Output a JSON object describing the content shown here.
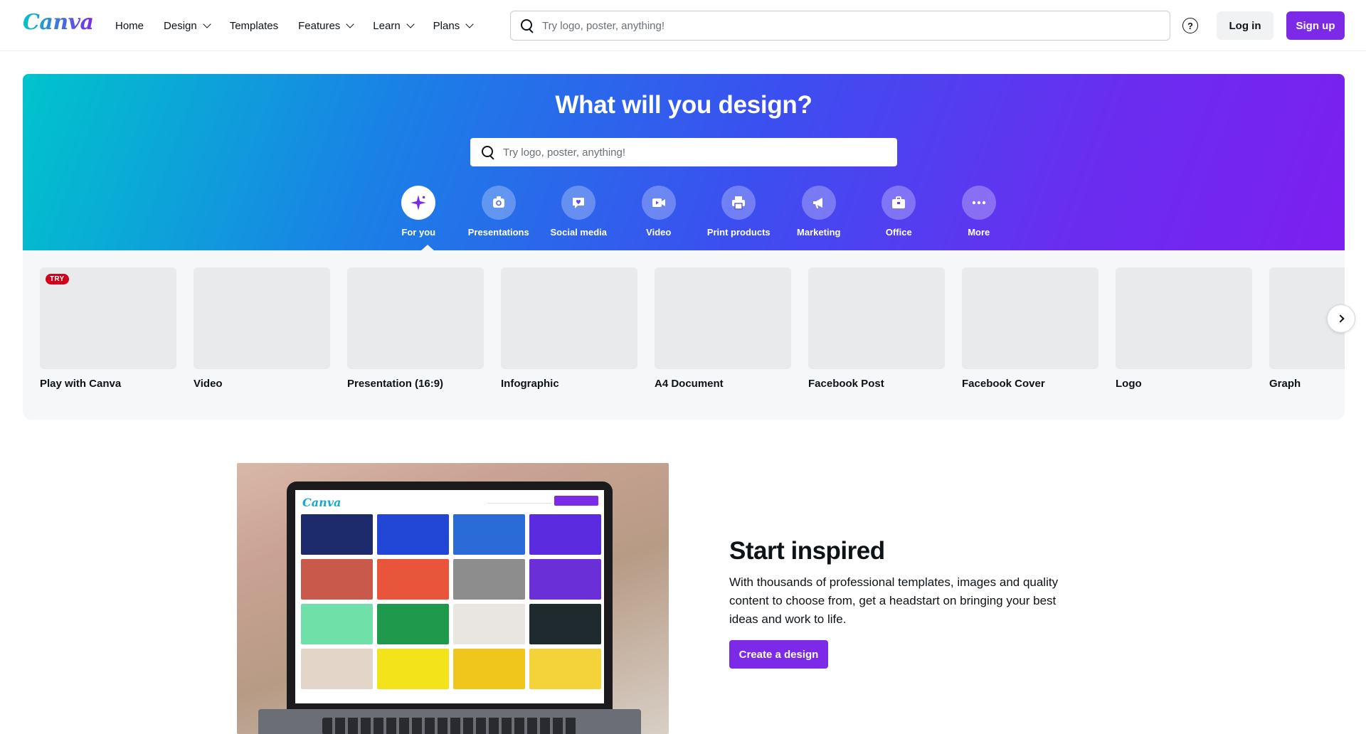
{
  "header": {
    "logo": "Canva",
    "nav": [
      {
        "label": "Home",
        "dropdown": false
      },
      {
        "label": "Design",
        "dropdown": true
      },
      {
        "label": "Templates",
        "dropdown": false
      },
      {
        "label": "Features",
        "dropdown": true
      },
      {
        "label": "Learn",
        "dropdown": true
      },
      {
        "label": "Plans",
        "dropdown": true
      }
    ],
    "search_placeholder": "Try logo, poster, anything!",
    "help_glyph": "?",
    "login_label": "Log in",
    "signup_label": "Sign up"
  },
  "hero": {
    "title": "What will you design?",
    "search_placeholder": "Try logo, poster, anything!",
    "categories": [
      {
        "label": "For you",
        "icon": "sparkle-icon",
        "active": true
      },
      {
        "label": "Presentations",
        "icon": "presentation-icon",
        "active": false
      },
      {
        "label": "Social media",
        "icon": "heart-chat-icon",
        "active": false
      },
      {
        "label": "Video",
        "icon": "video-camera-icon",
        "active": false
      },
      {
        "label": "Print products",
        "icon": "printer-icon",
        "active": false
      },
      {
        "label": "Marketing",
        "icon": "megaphone-icon",
        "active": false
      },
      {
        "label": "Office",
        "icon": "briefcase-icon",
        "active": false
      },
      {
        "label": "More",
        "icon": "more-dots-icon",
        "active": false
      }
    ]
  },
  "tiles": {
    "badge": "TRY",
    "items": [
      {
        "label": "Play with Canva"
      },
      {
        "label": "Video"
      },
      {
        "label": "Presentation (16:9)"
      },
      {
        "label": "Infographic"
      },
      {
        "label": "A4 Document"
      },
      {
        "label": "Facebook Post"
      },
      {
        "label": "Facebook Cover"
      },
      {
        "label": "Logo"
      },
      {
        "label": "Graph"
      }
    ]
  },
  "inspired": {
    "title": "Start inspired",
    "body": "With thousands of professional templates, images and quality content to choose from, get a headstart on bringing your best ideas and work to life.",
    "cta": "Create a design",
    "screen_logo": "Canva"
  },
  "colors": {
    "brand_purple": "#7d2ae8",
    "brand_teal": "#00c4cc",
    "try_badge": "#d0021b"
  }
}
